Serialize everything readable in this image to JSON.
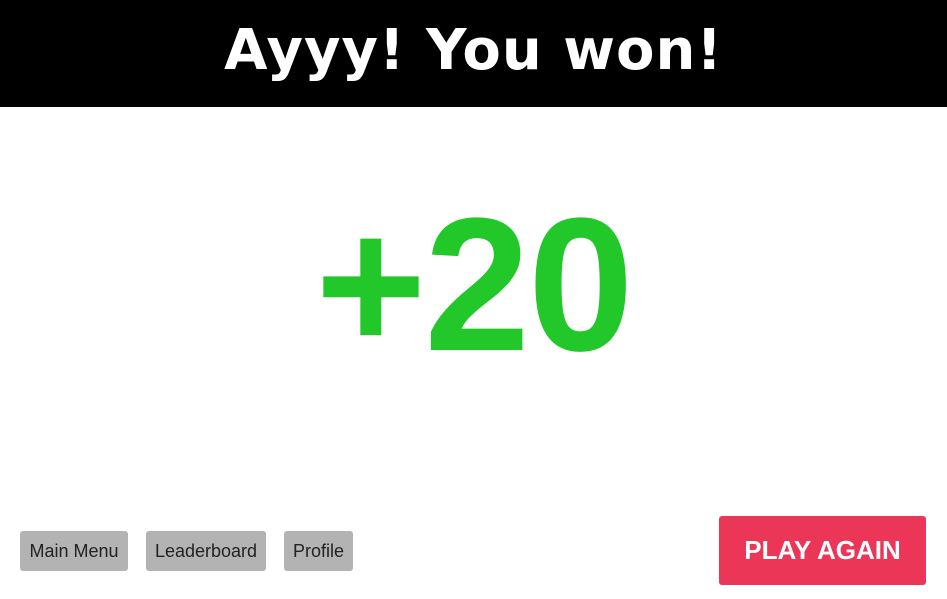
{
  "header": {
    "title": "Ayyy! You won!"
  },
  "result": {
    "score_change": "+20"
  },
  "nav": {
    "main_menu": "Main Menu",
    "leaderboard": "Leaderboard",
    "profile": "Profile"
  },
  "actions": {
    "play_again": "PLAY AGAIN"
  },
  "colors": {
    "header_bg": "#000000",
    "score": "#22c72a",
    "nav_button_bg": "#b3b3b3",
    "play_button_bg": "#eb3658"
  }
}
